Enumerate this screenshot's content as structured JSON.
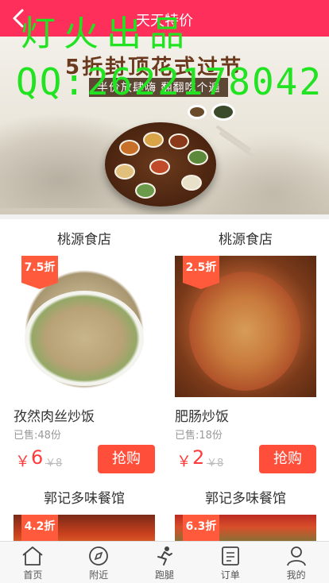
{
  "header": {
    "title": "天天特价"
  },
  "watermark": {
    "line1": "灯火出品",
    "line2": "QQ:2622178042"
  },
  "banner": {
    "headline": "5折封顶花式过节",
    "subline": "半价放肆嗨 翻翻吃个遍"
  },
  "products": [
    {
      "shop": "桃源食店",
      "discount": "7.5折",
      "name": "孜然肉丝炒饭",
      "sold": "已售:48份",
      "currency": "￥",
      "price": "6",
      "old_price": "￥8",
      "buy_label": "抢购"
    },
    {
      "shop": "桃源食店",
      "discount": "2.5折",
      "name": "肥肠炒饭",
      "sold": "已售:18份",
      "currency": "￥",
      "price": "2",
      "old_price": "￥8",
      "buy_label": "抢购"
    },
    {
      "shop": "郭记多味餐馆",
      "discount": "4.2折"
    },
    {
      "shop": "郭记多味餐馆",
      "discount": "6.3折"
    }
  ],
  "tabbar": {
    "items": [
      {
        "label": "首页",
        "icon": "home-icon"
      },
      {
        "label": "附近",
        "icon": "compass-icon"
      },
      {
        "label": "跑腿",
        "icon": "runner-icon"
      },
      {
        "label": "订单",
        "icon": "order-icon"
      },
      {
        "label": "我的",
        "icon": "user-icon"
      }
    ]
  },
  "colors": {
    "header": "#ff2f5b",
    "accent": "#ff4f3b",
    "watermark": "#22e322"
  }
}
